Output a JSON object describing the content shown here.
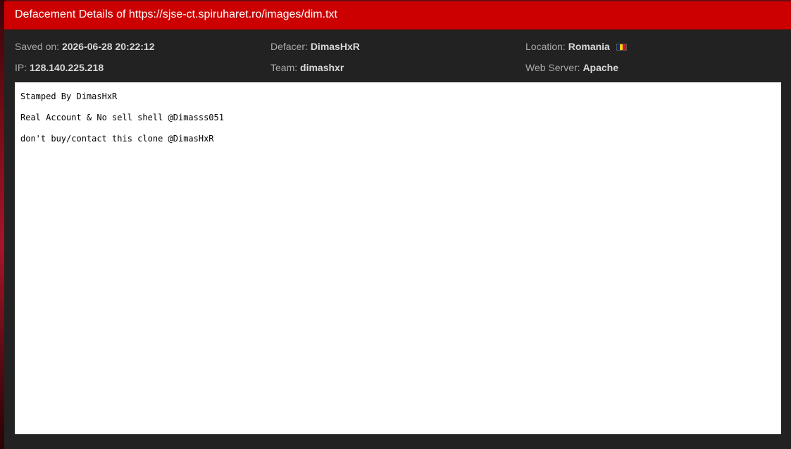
{
  "header": {
    "title": "Defacement Details of https://sjse-ct.spiruharet.ro/images/dim.txt"
  },
  "meta": {
    "saved_on": {
      "label": "Saved on:",
      "value": "2026-06-28 20:22:12"
    },
    "ip": {
      "label": "IP:",
      "value": "128.140.225.218"
    },
    "defacer": {
      "label": "Defacer:",
      "value": "DimasHxR"
    },
    "team": {
      "label": "Team:",
      "value": "dimashxr"
    },
    "location": {
      "label": "Location:",
      "value": "Romania",
      "flag_icon": "romania-flag-icon",
      "flag_colors": [
        "#002b7f",
        "#fcd116",
        "#ce1126"
      ]
    },
    "web_server": {
      "label": "Web Server:",
      "value": "Apache"
    }
  },
  "content": {
    "lines": [
      "Stamped By DimasHxR",
      "Real Account & No sell shell @Dimasss051",
      "don't buy/contact this clone @DimasHxR"
    ]
  },
  "colors": {
    "header_bg": "#cc0000",
    "panel_bg": "#222222",
    "content_bg": "#ffffff"
  }
}
